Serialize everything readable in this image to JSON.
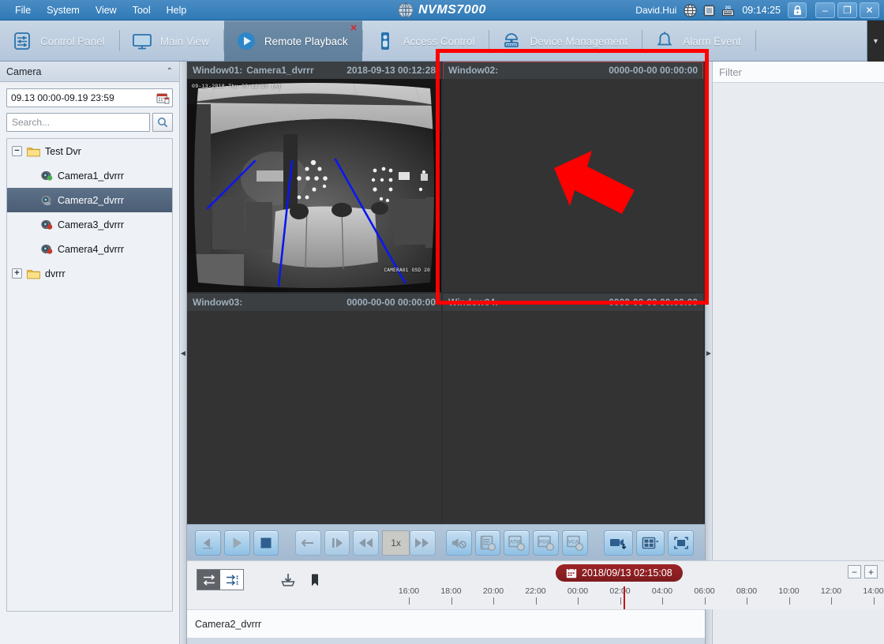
{
  "titlebar": {
    "menus": [
      "File",
      "System",
      "View",
      "Tool",
      "Help"
    ],
    "brand": "NVMS7000",
    "brand_icon": "globe-logo-icon",
    "user": "David.Hui",
    "icons": [
      "network-globe-icon",
      "cpu-chip-icon",
      "keyboard-icon"
    ],
    "clock": "09:14:25",
    "lock_icon": "lock-icon",
    "window_controls": [
      {
        "name": "minimize-button",
        "glyph": "–"
      },
      {
        "name": "maximize-button",
        "glyph": "❐"
      },
      {
        "name": "close-button",
        "glyph": "✕"
      }
    ]
  },
  "tabs": [
    {
      "label": "Control Panel",
      "icon": "sliders-icon",
      "active": false,
      "closable": false
    },
    {
      "label": "Main View",
      "icon": "monitor-icon",
      "active": false,
      "closable": false
    },
    {
      "label": "Remote Playback",
      "icon": "play-circle-icon",
      "active": true,
      "closable": true,
      "close_glyph": "✕"
    },
    {
      "label": "Access Control",
      "icon": "door-access-icon",
      "active": false,
      "closable": false
    },
    {
      "label": "Device Management",
      "icon": "dome-camera-icon",
      "active": false,
      "closable": false
    },
    {
      "label": "Alarm Event",
      "icon": "bell-icon",
      "active": false,
      "closable": false
    }
  ],
  "tab_overflow": {
    "name": "tab-overflow-dropdown",
    "glyph": "▼"
  },
  "sidebar": {
    "title": "Camera",
    "collapse_glyph": "⌃",
    "date_range": "09.13 00:00-09.19 23:59",
    "calendar_icon": "calendar-icon",
    "search_placeholder": "Search...",
    "search_icon": "magnifier-icon",
    "tree": [
      {
        "label": "Test Dvr",
        "type": "folder",
        "level": 0,
        "expander": "−",
        "selected": false,
        "icon": "folder-icon"
      },
      {
        "label": "Camera1_dvrrr",
        "type": "camera",
        "level": 1,
        "selected": false,
        "icon": "camera-icon-green"
      },
      {
        "label": "Camera2_dvrrr",
        "type": "camera",
        "level": 1,
        "selected": true,
        "icon": "camera-icon-blue"
      },
      {
        "label": "Camera3_dvrrr",
        "type": "camera",
        "level": 1,
        "selected": false,
        "icon": "camera-icon-red"
      },
      {
        "label": "Camera4_dvrrr",
        "type": "camera",
        "level": 1,
        "selected": false,
        "icon": "camera-icon-red"
      },
      {
        "label": "dvrrr",
        "type": "folder",
        "level": 0,
        "expander": "+",
        "selected": false,
        "icon": "folder-icon"
      }
    ]
  },
  "splitters": {
    "left_collapse_glyph": "◀",
    "right_expand_glyph": "▶"
  },
  "video_windows": [
    {
      "name": "Window01:",
      "camera": "Camera1_dvrrr",
      "timestamp": "2018-09-13 00:12:28",
      "has_video": true,
      "selected": false,
      "osd_top": "09-13-2018 Thu 00:12:29 (A)",
      "osd_bottom": "CAMERA01 OSD 20"
    },
    {
      "name": "Window02:",
      "camera": "",
      "timestamp": "0000-00-00 00:00:00",
      "has_video": false,
      "selected": true
    },
    {
      "name": "Window03:",
      "camera": "",
      "timestamp": "0000-00-00 00:00:00",
      "has_video": false,
      "selected": false
    },
    {
      "name": "Window04:",
      "camera": "",
      "timestamp": "0000-00-00 00:00:00",
      "has_video": false,
      "selected": false
    }
  ],
  "right_panel": {
    "filter_placeholder": "Filter"
  },
  "playback_toolbar": {
    "left_buttons": [
      {
        "name": "reverse-play-button",
        "icon": "reverse-play-icon"
      },
      {
        "name": "play-button",
        "icon": "play-icon"
      },
      {
        "name": "stop-button",
        "icon": "stop-icon"
      }
    ],
    "nav_buttons": [
      {
        "name": "step-back-button",
        "icon": "arrow-left-icon"
      },
      {
        "name": "single-frame-button",
        "icon": "frame-step-icon"
      },
      {
        "name": "slow-forward-button",
        "icon": "rewind-icon"
      }
    ],
    "speed_label": "1x",
    "after_speed": [
      {
        "name": "fast-forward-button",
        "icon": "fast-forward-icon"
      },
      {
        "name": "audio-mute-button",
        "icon": "speaker-mute-icon"
      }
    ],
    "right_buttons": [
      {
        "name": "file-list-button",
        "icon": "file-list-icon",
        "label": ""
      },
      {
        "name": "atm-info-button",
        "icon": "atm-icon",
        "label": "ATM"
      },
      {
        "name": "pos-info-button",
        "icon": "pos-icon",
        "label": "POS"
      },
      {
        "name": "vca-search-button",
        "icon": "vca-icon",
        "label": "VCA"
      },
      {
        "name": "capture-download-button",
        "icon": "camcorder-download-icon",
        "label": ""
      },
      {
        "name": "window-layout-button",
        "icon": "grid-layout-icon",
        "label": ""
      },
      {
        "name": "fullscreen-button",
        "icon": "fullscreen-icon",
        "label": ""
      }
    ]
  },
  "timeline": {
    "view_toggle": [
      {
        "name": "timeline-mode-button",
        "icon": "timeline-mode-icon",
        "active": true
      },
      {
        "name": "list-mode-button",
        "icon": "list-mode-icon",
        "active": false
      }
    ],
    "download_icon": "download-icon",
    "tag_icon": "bookmark-icon",
    "current_time": "2018/09/13 02:15:08",
    "pill_calendar_icon": "calendar-small-icon",
    "zoom_out_glyph": "−",
    "zoom_in_glyph": "+",
    "ticks": [
      "16:00",
      "18:00",
      "20:00",
      "22:00",
      "00:00",
      "02:00",
      "04:00",
      "06:00",
      "08:00",
      "10:00",
      "12:00",
      "14:00"
    ],
    "playhead_time": "02:15"
  },
  "bottom_list": {
    "rows": [
      "Camera2_dvrrr"
    ]
  },
  "annotation": {
    "box_color": "#fe0000",
    "arrow_color": "#fe0000",
    "target": "Window02 video cell"
  }
}
